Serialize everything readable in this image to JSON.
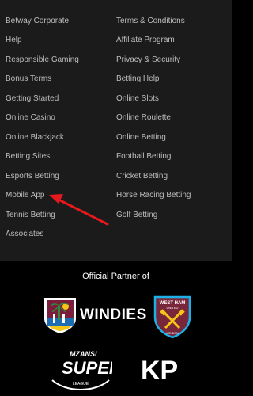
{
  "footer": {
    "left_links": [
      "Betway Corporate",
      "Help",
      "Responsible Gaming",
      "Bonus Terms",
      "Getting Started",
      "Online Casino",
      "Online Blackjack",
      "Betting Sites",
      "Esports Betting",
      "Mobile App",
      "Tennis Betting",
      "Associates"
    ],
    "right_links": [
      "Terms & Conditions",
      "Affiliate Program",
      "Privacy & Security",
      "Betting Help",
      "Online Slots",
      "Online Roulette",
      "Online Betting",
      "Football Betting",
      "Cricket Betting",
      "Horse Racing Betting",
      "Golf Betting"
    ]
  },
  "partners": {
    "title": "Official Partner of",
    "windies": "WINDIES",
    "west_ham": {
      "line1": "WEST HAM",
      "line2": "UNITED",
      "line3": "LONDON"
    },
    "mzansi": {
      "line1": "MZANSI",
      "line2": "SUPER",
      "line3": "LEAGUE"
    },
    "kp": "KP"
  },
  "colors": {
    "panel_bg": "#1b1b1b",
    "page_bg": "#000000",
    "link_text": "#bdbdbd",
    "annotation_arrow": "#e8191d",
    "west_ham_claret": "#7a263a",
    "west_ham_blue": "#1bb1e7"
  },
  "icons": [
    "windies-logo",
    "west-ham-crest",
    "mzansi-super-league-logo",
    "kp-logo",
    "red-arrow-annotation"
  ]
}
